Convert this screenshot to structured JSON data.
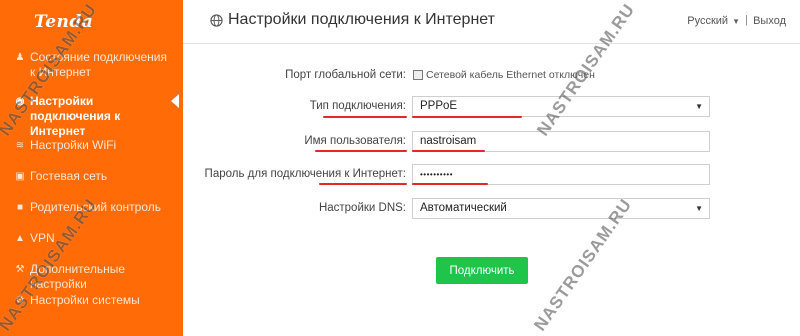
{
  "brand": {
    "logo_text": "Tenda"
  },
  "sidebar": {
    "items": [
      {
        "label": "Состояние подключения к Интернет",
        "icon": "person-icon"
      },
      {
        "label": "Настройки подключения к Интернет",
        "icon": "globe-icon",
        "active": true
      },
      {
        "label": "Настройки WiFi",
        "icon": "wifi-icon"
      },
      {
        "label": "Гостевая сеть",
        "icon": "guest-icon"
      },
      {
        "label": "Родительский контроль",
        "icon": "shield-icon"
      },
      {
        "label": "VPN",
        "icon": "vpn-icon"
      },
      {
        "label": "Дополнительные настройки",
        "icon": "wrench-icon"
      },
      {
        "label": "Настройки системы",
        "icon": "gear-icon"
      }
    ]
  },
  "header": {
    "title": "Настройки подключения к Интернет",
    "language": "Русский",
    "separator": "|",
    "logout": "Выход"
  },
  "form": {
    "wan_port_label": "Порт глобальной сети:",
    "wan_port_status": "Сетевой кабель Ethernet отключен",
    "conn_type_label": "Тип подключения:",
    "conn_type_value": "PPPoE",
    "username_label": "Имя пользователя:",
    "username_value": "nastroisam",
    "password_label": "Пароль для подключения к Интернет:",
    "password_value": "••••••••••",
    "dns_label": "Настройки DNS:",
    "dns_value": "Автоматический",
    "connect_label": "Подключить"
  },
  "watermark": {
    "text": "NASTROISAM.RU"
  },
  "colors": {
    "sidebar": "#ff6b06",
    "accent_button": "#1ec54a",
    "highlight_underline": "#e02a2a"
  }
}
